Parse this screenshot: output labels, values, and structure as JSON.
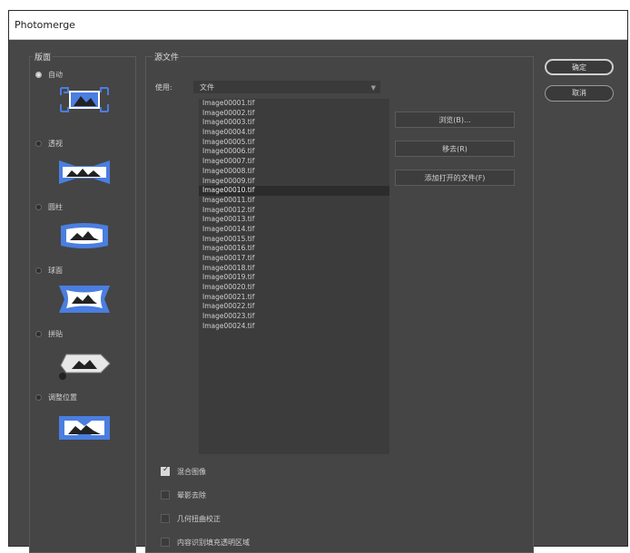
{
  "window": {
    "title": "Photomerge"
  },
  "layout": {
    "label": "版面",
    "options": [
      {
        "label": "自动",
        "selected": true
      },
      {
        "label": "透视",
        "selected": false
      },
      {
        "label": "圆柱",
        "selected": false
      },
      {
        "label": "球面",
        "selected": false
      },
      {
        "label": "拼贴",
        "selected": false
      },
      {
        "label": "调整位置",
        "selected": false
      }
    ]
  },
  "source": {
    "label": "源文件",
    "use_label": "使用:",
    "use_value": "文件",
    "files": [
      "Image00001.tif",
      "Image00002.tif",
      "Image00003.tif",
      "Image00004.tif",
      "Image00005.tif",
      "Image00006.tif",
      "Image00007.tif",
      "Image00008.tif",
      "Image00009.tif",
      "Image00010.tif",
      "Image00011.tif",
      "Image00012.tif",
      "Image00013.tif",
      "Image00014.tif",
      "Image00015.tif",
      "Image00016.tif",
      "Image00017.tif",
      "Image00018.tif",
      "Image00019.tif",
      "Image00020.tif",
      "Image00021.tif",
      "Image00022.tif",
      "Image00023.tif",
      "Image00024.tif"
    ],
    "selected_file": "Image00010.tif",
    "browse_label": "浏览(B)...",
    "remove_label": "移去(R)",
    "add_open_label": "添加打开的文件(F)"
  },
  "options": [
    {
      "label": "混合图像",
      "checked": true
    },
    {
      "label": "晕影去除",
      "checked": false
    },
    {
      "label": "几何扭曲校正",
      "checked": false
    },
    {
      "label": "内容识别填充透明区域",
      "checked": false
    }
  ],
  "buttons": {
    "ok": "确定",
    "cancel": "取消"
  },
  "colors": {
    "dialog_bg": "#474747",
    "icon_blue": "#3b6fd6"
  }
}
